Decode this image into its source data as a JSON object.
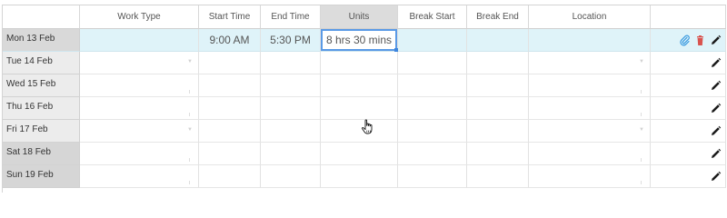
{
  "grid": {
    "headers": [
      "",
      "Work Type",
      "Start Time",
      "End Time",
      "Units",
      "Break Start",
      "Break End",
      "Location",
      ""
    ],
    "rows": [
      {
        "date": "Mon 13 Feb",
        "start_time": "9:00 AM",
        "end_time": "5:30 PM",
        "units": "8 hrs 30 mins"
      },
      {
        "date": "Tue 14 Feb",
        "start_time": "",
        "end_time": "",
        "units": ""
      },
      {
        "date": "Wed 15 Feb",
        "start_time": "",
        "end_time": "",
        "units": ""
      },
      {
        "date": "Thu 16 Feb",
        "start_time": "",
        "end_time": "",
        "units": ""
      },
      {
        "date": "Fri 17 Feb",
        "start_time": "",
        "end_time": "",
        "units": ""
      },
      {
        "date": "Sat 18 Feb",
        "start_time": "",
        "end_time": "",
        "units": ""
      },
      {
        "date": "Sun 19 Feb",
        "start_time": "",
        "end_time": "",
        "units": ""
      }
    ]
  },
  "icons": {
    "attach": "paperclip-icon",
    "delete": "trash-icon",
    "edit": "pencil-icon"
  },
  "colors": {
    "selected_row_bg": "#dff3f9",
    "active_border": "#5a9ae6",
    "attach_icon": "#3a9ae0",
    "delete_icon": "#d9534f",
    "edit_icon": "#1a1a1a"
  }
}
